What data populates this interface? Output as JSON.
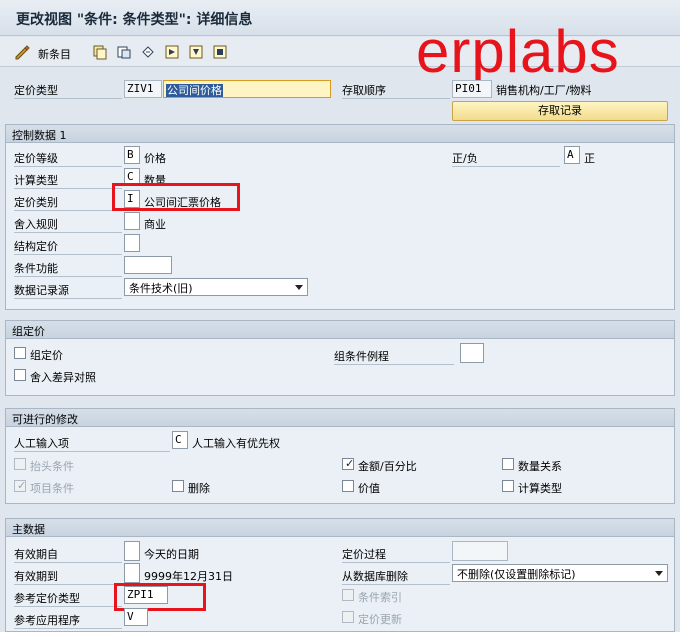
{
  "title": "更改视图 \"条件: 条件类型\": 详细信息",
  "watermark": "erplabs",
  "toolbar": {
    "new_entries_label": "新条目",
    "icons": [
      "edit-icon",
      "copy-icon",
      "delete-icon",
      "undo-icon",
      "first-page-icon",
      "previous-page-icon",
      "next-page-icon"
    ]
  },
  "header": {
    "pricing_type_label": "定价类型",
    "pricing_type_code": "ZIV1",
    "pricing_type_desc": "公司间价格",
    "access_seq_label": "存取顺序",
    "access_seq_code": "PI01",
    "access_seq_desc": "销售机构/工厂/物料",
    "access_records_button": "存取记录"
  },
  "control": {
    "title": "控制数据 1",
    "level_label": "定价等级",
    "level_code": "B",
    "level_desc": "价格",
    "sign_label": "正/负",
    "sign_code": "A",
    "sign_desc": "正",
    "calc_type_label": "计算类型",
    "calc_type_code": "C",
    "calc_type_desc": "数量",
    "category_label": "定价类别",
    "category_code": "I",
    "category_desc": "公司间汇票价格",
    "rounding_label": "舍入规则",
    "rounding_code": "",
    "rounding_desc": "商业",
    "structure_label": "结构定价",
    "structure_code": "",
    "function_label": "条件功能",
    "function_value": "",
    "source_label": "数据记录源",
    "source_value": "条件技术(旧)"
  },
  "group_cond": {
    "title": "组定价",
    "group_cond_label": "组定价",
    "group_cond_checked": false,
    "rounding_diff_label": "舍入差异对照",
    "rounding_diff_checked": false,
    "routine_label": "组条件例程",
    "routine_value": ""
  },
  "changes": {
    "title": "可进行的修改",
    "manual_label": "人工输入项",
    "manual_code": "C",
    "manual_desc": "人工输入有优先权",
    "header_cond_label": "抬头条件",
    "header_cond_checked": false,
    "amount_pct_label": "金额/百分比",
    "amount_pct_checked": true,
    "qty_rel_label": "数量关系",
    "qty_rel_checked": false,
    "item_cond_label": "项目条件",
    "item_cond_checked": true,
    "delete_label": "删除",
    "delete_checked": false,
    "value_label": "价值",
    "value_checked": false,
    "calc_type_label": "计算类型",
    "calc_type_checked": false
  },
  "master": {
    "title": "主数据",
    "valid_from_label": "有效期自",
    "valid_from_code": "",
    "valid_from_desc": "今天的日期",
    "pricing_proc_label": "定价过程",
    "pricing_proc_value": "",
    "valid_to_label": "有效期到",
    "valid_to_code": "",
    "valid_to_desc": "9999年12月31日",
    "db_delete_label": "从数据库删除",
    "db_delete_value": "不删除(仅设置删除标记)",
    "ref_type_label": "参考定价类型",
    "ref_type_value": "ZPI1",
    "cond_index_label": "条件索引",
    "cond_index_checked": false,
    "ref_app_label": "参考应用程序",
    "ref_app_value": "V",
    "price_update_label": "定价更新",
    "price_update_checked": false
  },
  "colors": {
    "highlight_red": "#e8141c",
    "group_header": "#c8d3df",
    "background": "#dfe6ee"
  }
}
